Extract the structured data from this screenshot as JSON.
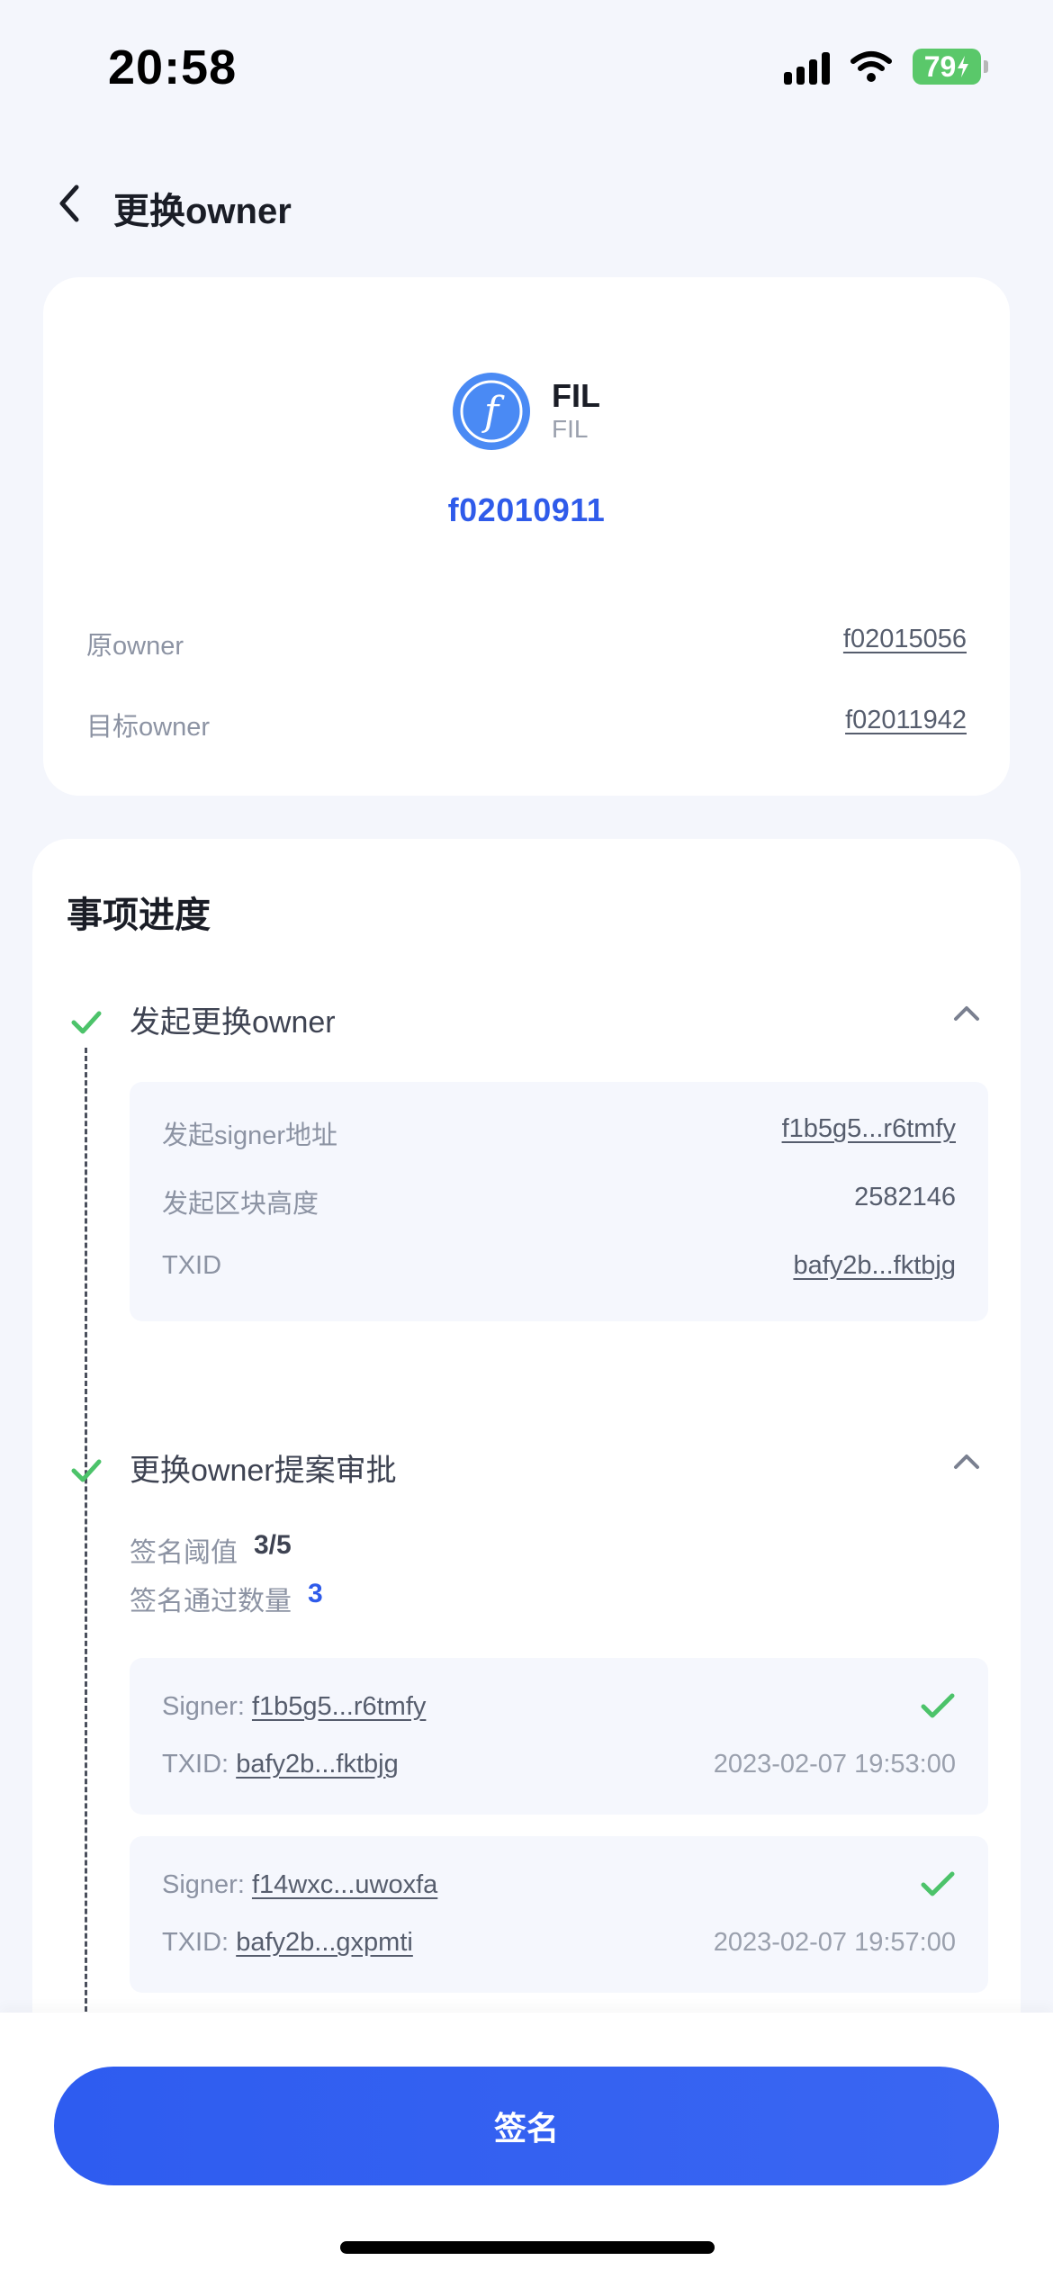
{
  "status_bar": {
    "time": "20:58",
    "battery": "79"
  },
  "nav": {
    "title": "更换owner"
  },
  "info": {
    "coin_symbol": "FIL",
    "coin_sub": "FIL",
    "miner_id": "f02010911",
    "original_owner_label": "原owner",
    "original_owner_value": "f02015056",
    "target_owner_label": "目标owner",
    "target_owner_value": "f02011942"
  },
  "progress": {
    "title": "事项进度",
    "step1": {
      "title": "发起更换owner",
      "rows": [
        {
          "label": "发起signer地址",
          "value": "f1b5g5...r6tmfy"
        },
        {
          "label": "发起区块高度",
          "value": "2582146"
        },
        {
          "label": "TXID",
          "value": "bafy2b...fktbjg"
        }
      ]
    },
    "step2": {
      "title": "更换owner提案审批",
      "threshold_label": "签名阈值",
      "threshold_value": "3/5",
      "passed_label": "签名通过数量",
      "passed_value": "3",
      "signers": [
        {
          "signer_label": "Signer:",
          "signer": "f1b5g5...r6tmfy",
          "txid_label": "TXID:",
          "txid": "bafy2b...fktbjg",
          "time": "2023-02-07 19:53:00"
        },
        {
          "signer_label": "Signer:",
          "signer": "f14wxc...uwoxfa",
          "txid_label": "TXID:",
          "txid": "bafy2b...gxpmti",
          "time": "2023-02-07 19:57:00"
        }
      ]
    }
  },
  "footer": {
    "sign_label": "签名"
  },
  "colors": {
    "accent": "#2f5bea",
    "check": "#4cc36a",
    "fil": "#4a8af4"
  }
}
